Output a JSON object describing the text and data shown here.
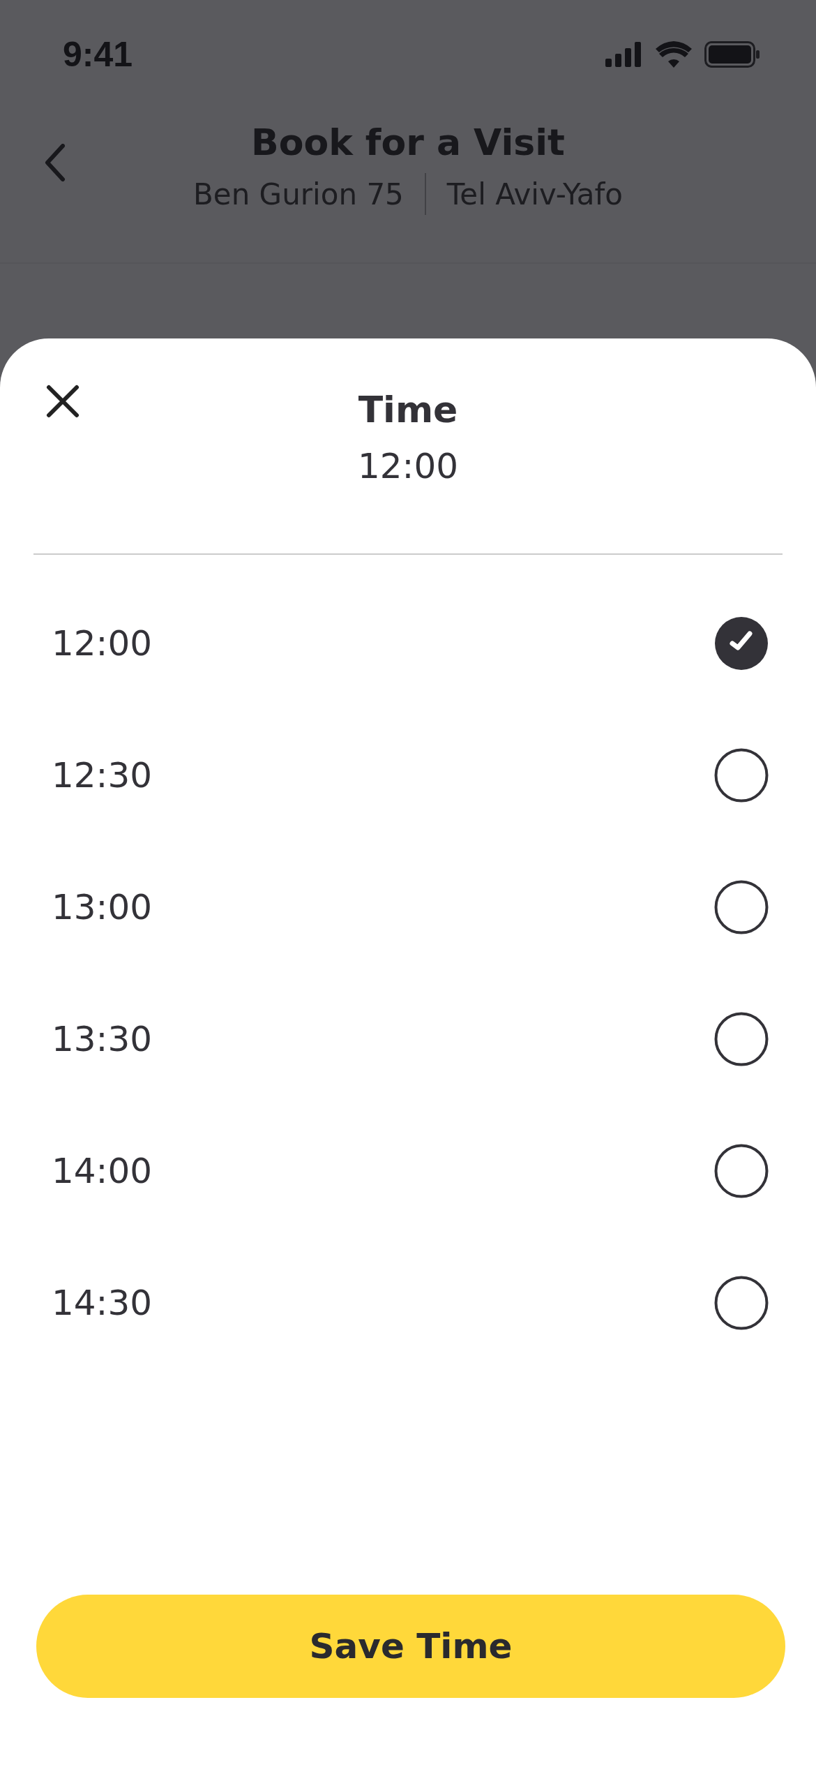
{
  "status_bar": {
    "time": "9:41"
  },
  "header": {
    "title": "Book for a Visit",
    "address": "Ben Gurion 75",
    "city": "Tel Aviv-Yafo"
  },
  "sheet": {
    "title": "Time",
    "current_value": "12:00",
    "options": [
      {
        "label": "12:00",
        "selected": true
      },
      {
        "label": "12:30",
        "selected": false
      },
      {
        "label": "13:00",
        "selected": false
      },
      {
        "label": "13:30",
        "selected": false
      },
      {
        "label": "14:00",
        "selected": false
      },
      {
        "label": "14:30",
        "selected": false
      }
    ],
    "save_button": "Save Time"
  }
}
